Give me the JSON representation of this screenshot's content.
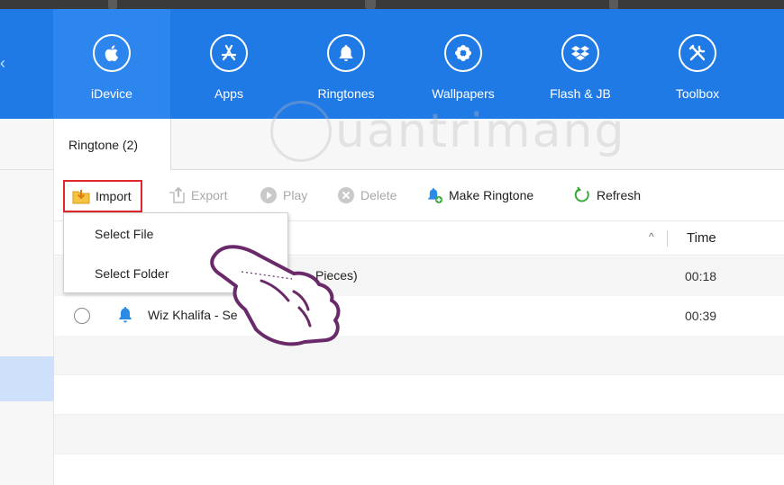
{
  "nav": {
    "items": [
      {
        "label": "iDevice",
        "icon": "apple-icon",
        "active": true
      },
      {
        "label": "Apps",
        "icon": "app-store-icon",
        "active": false
      },
      {
        "label": "Ringtones",
        "icon": "bell-icon",
        "active": false
      },
      {
        "label": "Wallpapers",
        "icon": "flower-icon",
        "active": false
      },
      {
        "label": "Flash & JB",
        "icon": "dropbox-box-icon",
        "active": false
      },
      {
        "label": "Toolbox",
        "icon": "wrench-screwdriver-icon",
        "active": false
      }
    ]
  },
  "tabs": [
    {
      "label": "Ringtone (2)"
    }
  ],
  "watermark": {
    "text": "uantrimang"
  },
  "toolbar": {
    "import": "Import",
    "export": "Export",
    "play": "Play",
    "delete": "Delete",
    "make_ringtone": "Make Ringtone",
    "refresh": "Refresh"
  },
  "table": {
    "time_header": "Time",
    "rows": [
      {
        "name": "Pieces)",
        "time": "00:18"
      },
      {
        "name": "Wiz Khalifa - Se",
        "time": "00:39"
      }
    ]
  },
  "dropdown": {
    "items": [
      "Select File",
      "Select Folder"
    ]
  },
  "colors": {
    "header_blue": "#1f7ae6",
    "active_nav": "#2d86ee",
    "highlight_red": "#e0272b",
    "bell_blue": "#2b8be8",
    "refresh_green": "#3aa83a",
    "hand_purple": "#6a2a6a"
  }
}
